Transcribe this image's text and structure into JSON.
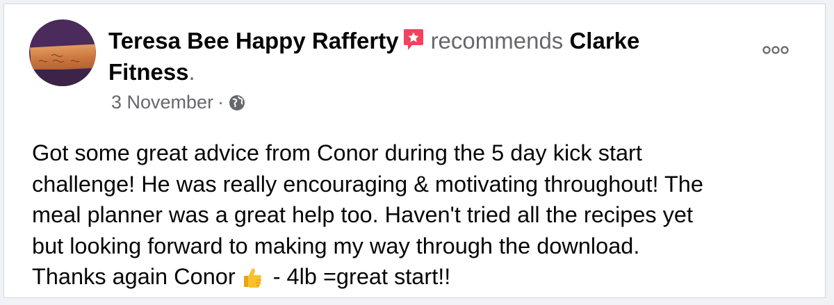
{
  "post": {
    "author": "Teresa Bee Happy Rafferty",
    "action": "recommends",
    "page": "Clarke",
    "page_line2": "Fitness",
    "period": ".",
    "date": "3 November",
    "separator": "·",
    "privacy_icon": "globe-icon",
    "badge_icon": "recommendation-star-icon",
    "more_icon": "more-options-icon",
    "body_lines": [
      "Got some great advice from Conor during the 5 day kick start",
      "challenge! He was really encouraging & motivating throughout! The",
      "meal planner was a great help too. Haven't tried all the recipes yet",
      "but looking forward to making my way through the download."
    ],
    "body_last_before": "Thanks again Conor",
    "body_last_emoji": "thumbs-up-emoji",
    "body_last_after": "- 4lb =great start!!"
  },
  "colors": {
    "text_primary": "#050505",
    "text_secondary": "#65676b",
    "badge": "#f3425f",
    "background": "#ffffff",
    "page_background": "#f0f2f5"
  }
}
